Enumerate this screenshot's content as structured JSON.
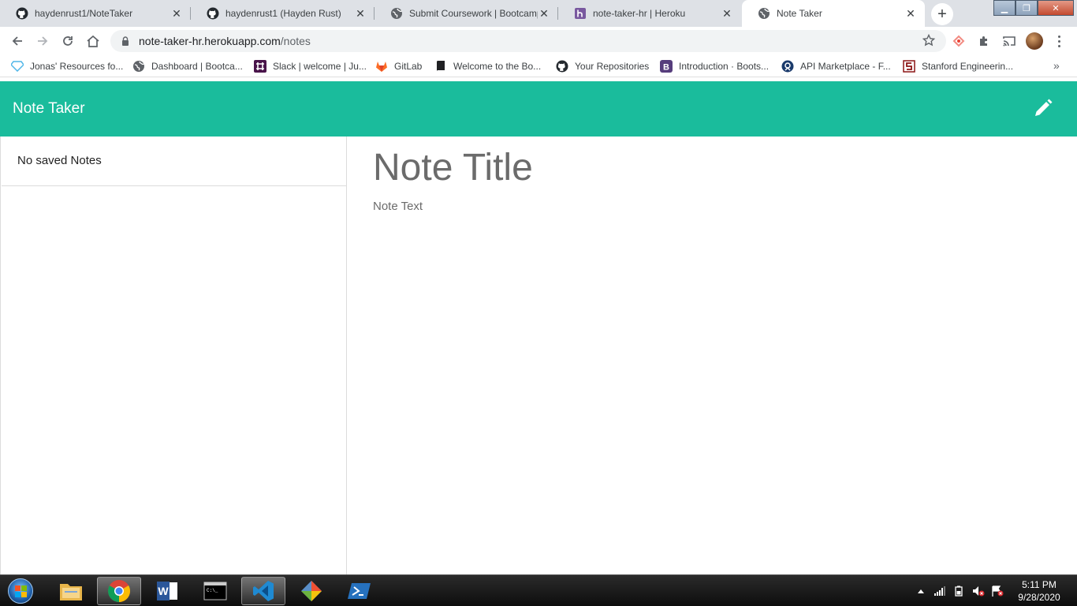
{
  "browser": {
    "tabs": [
      {
        "title": "haydenrust1/NoteTaker",
        "icon": "github-icon"
      },
      {
        "title": "haydenrust1 (Hayden Rust)",
        "icon": "github-icon"
      },
      {
        "title": "Submit Coursework | Bootcamp",
        "icon": "globe-icon"
      },
      {
        "title": "note-taker-hr | Heroku",
        "icon": "heroku-icon"
      },
      {
        "title": "Note Taker",
        "icon": "globe-icon"
      }
    ],
    "address": {
      "host": "note-taker-hr.herokuapp.com",
      "path": "/notes"
    },
    "bookmarks": [
      {
        "label": "Jonas' Resources fo...",
        "icon": "diamond-icon"
      },
      {
        "label": "Dashboard | Bootca...",
        "icon": "globe-icon"
      },
      {
        "label": "Slack | welcome | Ju...",
        "icon": "slack-icon"
      },
      {
        "label": "GitLab",
        "icon": "gitlab-icon"
      },
      {
        "label": "Welcome to the Bo...",
        "icon": "book-icon"
      },
      {
        "label": "Your Repositories",
        "icon": "github-icon"
      },
      {
        "label": "Introduction · Boots...",
        "icon": "bootstrap-icon"
      },
      {
        "label": "API Marketplace - F...",
        "icon": "rapidapi-icon"
      },
      {
        "label": "Stanford Engineerin...",
        "icon": "stanford-icon"
      }
    ],
    "bookmarks_more": "»"
  },
  "app": {
    "brand": "Note Taker",
    "sidebar": {
      "empty_label": "No saved Notes"
    },
    "editor": {
      "title_placeholder": "Note Title",
      "text_placeholder": "Note Text"
    },
    "accent_color": "#1abc9c"
  },
  "taskbar": {
    "apps": [
      "file-explorer",
      "chrome",
      "word",
      "command-prompt",
      "vscode",
      "git",
      "powershell"
    ],
    "time": "5:11 PM",
    "date": "9/28/2020"
  }
}
